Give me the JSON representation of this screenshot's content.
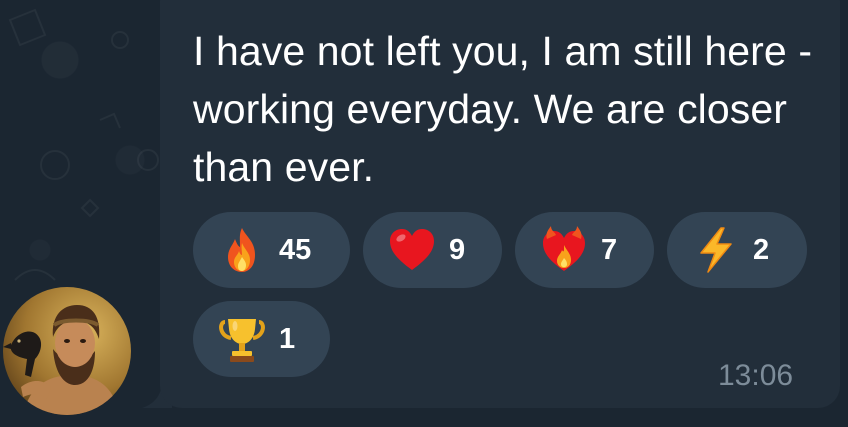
{
  "message": {
    "text": "I have not left you, I am still here - working everyday. We are closer than ever.",
    "time": "13:06"
  },
  "reactions": [
    {
      "emoji": "fire-icon",
      "count": "45"
    },
    {
      "emoji": "red-heart-icon",
      "count": "9"
    },
    {
      "emoji": "heart-on-fire-icon",
      "count": "7"
    },
    {
      "emoji": "high-voltage-icon",
      "count": "2"
    },
    {
      "emoji": "trophy-icon",
      "count": "1"
    }
  ],
  "colors": {
    "background": "#1b2631",
    "bubble": "#222e3a",
    "reaction_pill": "#334454",
    "text": "#ffffff",
    "timestamp": "#7d8c99"
  }
}
